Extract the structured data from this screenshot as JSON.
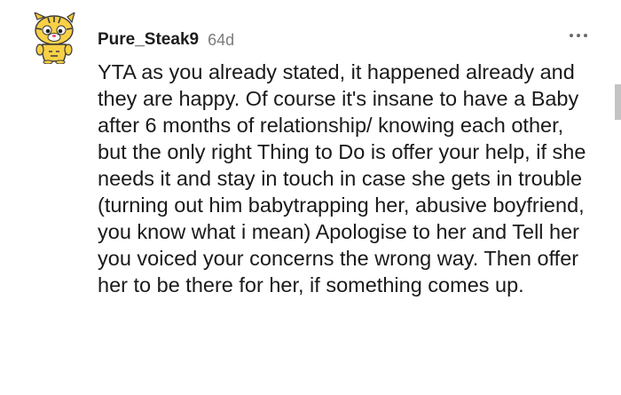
{
  "comment": {
    "author": "Pure_Steak9",
    "age": "64d",
    "body": "YTA as you already stated, it happened already and they are happy. Of course it's insane to have a Baby after 6 months of relationship/ knowing each other, but the only right Thing to Do is offer your help, if she needs it and stay in touch in case she gets in trouble (turning out him babytrapping her, abusive boyfriend, you know what i mean) Apologise to her and Tell her you voiced your concerns the wrong way. Then offer her to be there for her, if something comes up."
  },
  "icons": {
    "avatar": "snoo-avatar-icon",
    "more": "more-options-icon"
  }
}
